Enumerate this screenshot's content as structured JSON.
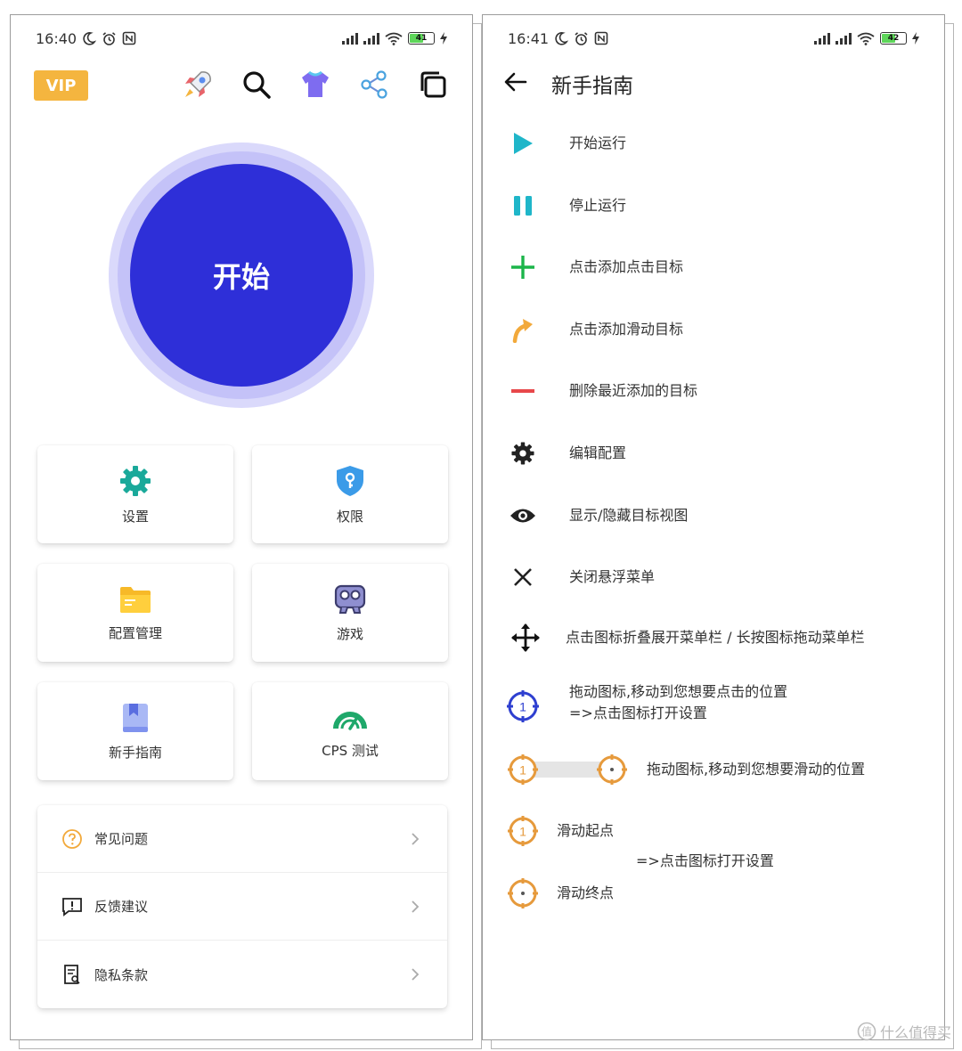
{
  "left": {
    "status": {
      "time": "16:40",
      "battery": "41"
    },
    "vip_label": "VIP",
    "start_label": "开始",
    "cards": [
      {
        "label": "设置"
      },
      {
        "label": "权限"
      },
      {
        "label": "配置管理"
      },
      {
        "label": "游戏"
      },
      {
        "label": "新手指南"
      },
      {
        "label": "CPS 测试"
      }
    ],
    "list": [
      {
        "label": "常见问题"
      },
      {
        "label": "反馈建议"
      },
      {
        "label": "隐私条款"
      }
    ]
  },
  "right": {
    "status": {
      "time": "16:41",
      "battery": "42"
    },
    "title": "新手指南",
    "items": [
      {
        "label": "开始运行"
      },
      {
        "label": "停止运行"
      },
      {
        "label": "点击添加点击目标"
      },
      {
        "label": "点击添加滑动目标"
      },
      {
        "label": "删除最近添加的目标"
      },
      {
        "label": "编辑配置"
      },
      {
        "label": "显示/隐藏目标视图"
      },
      {
        "label": "关闭悬浮菜单"
      },
      {
        "label": "点击图标折叠展开菜单栏 / 长按图标拖动菜单栏"
      },
      {
        "label": "拖动图标,移动到您想要点击的位置",
        "line2": "=>点击图标打开设置"
      },
      {
        "label": "拖动图标,移动到您想要滑动的位置"
      },
      {
        "label": "滑动起点"
      },
      {
        "label": "=>点击图标打开设置"
      },
      {
        "label": "滑动终点"
      }
    ],
    "marker_number": "1"
  },
  "watermark": "什么值得买",
  "colors": {
    "start_blue": "#2e2fd8",
    "vip_orange": "#f4b53f",
    "play_teal": "#1fb6c9",
    "plus_green": "#1cb54a",
    "swipe_orange": "#f2a93b",
    "minus_red": "#e8474a",
    "target_blue": "#2e3fd0",
    "target_orange": "#e69a3c"
  }
}
